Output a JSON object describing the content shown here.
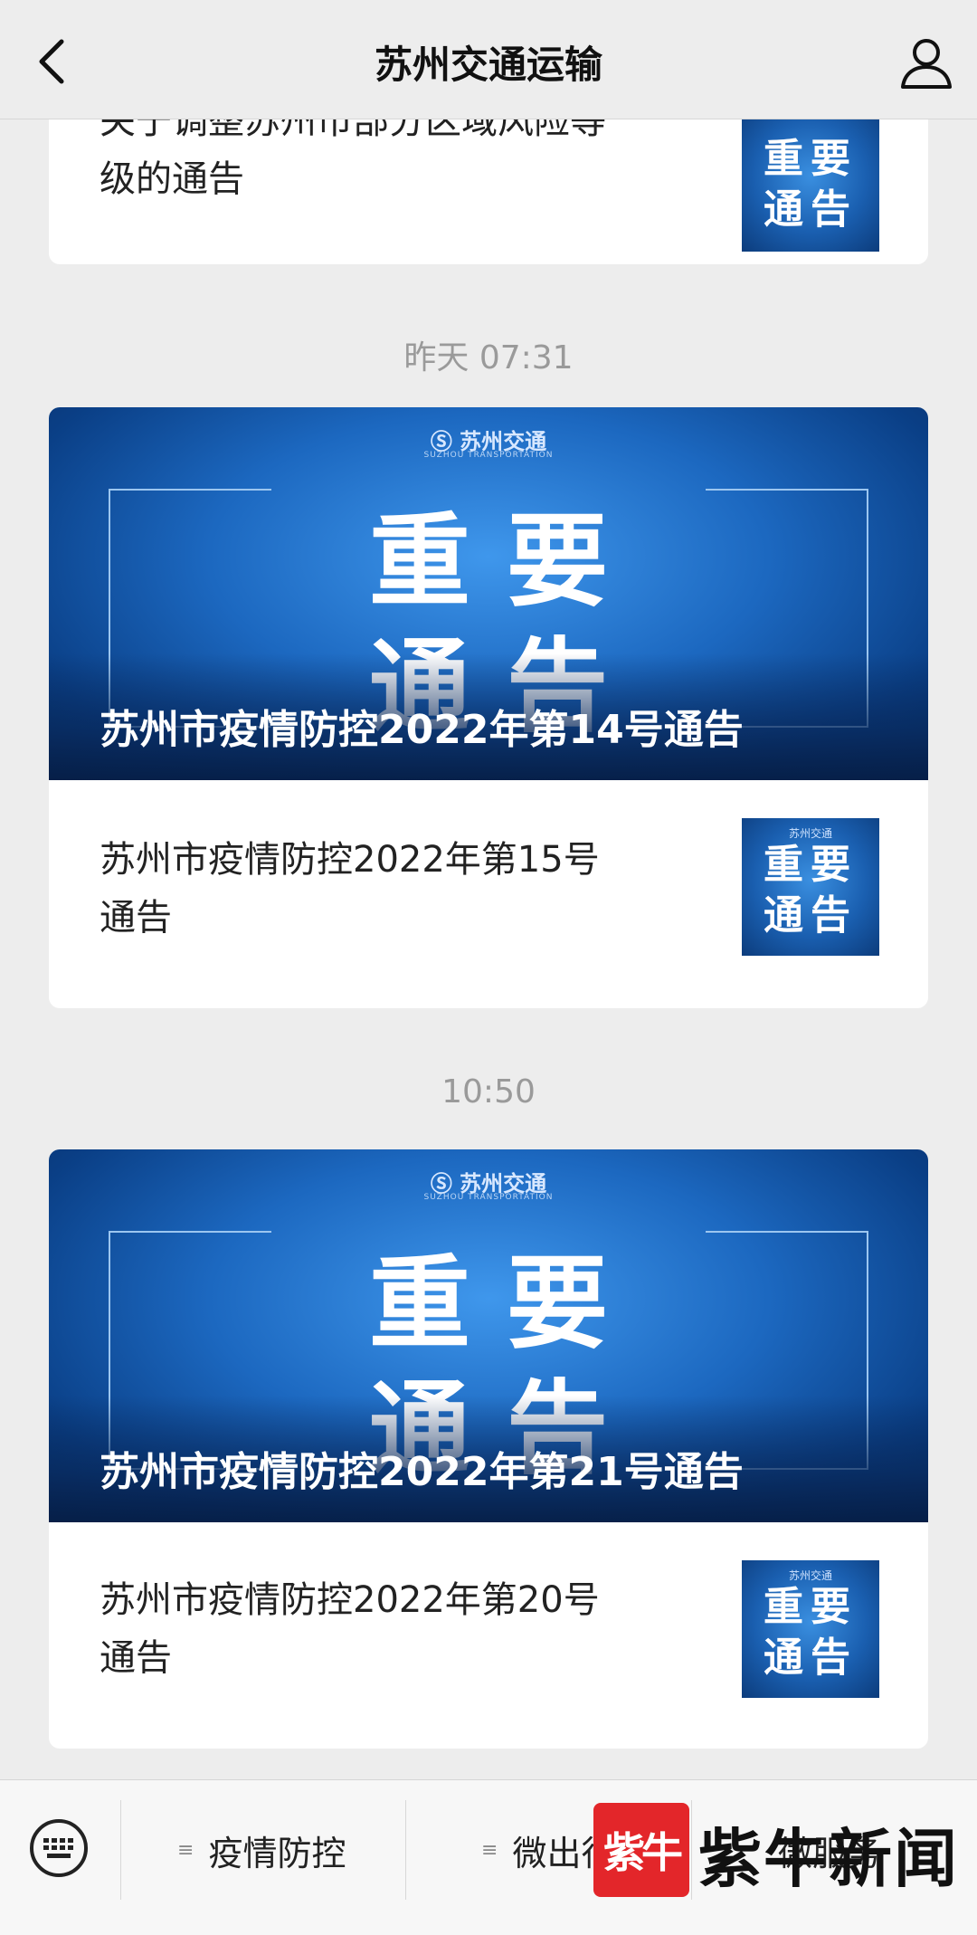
{
  "header": {
    "title": "苏州交通运输"
  },
  "messages": [
    {
      "type": "article",
      "partial_title_line1": "关于调整苏州市部分区域风险等",
      "partial_title_line2": "级的通告",
      "thumb_text_top": "重要",
      "thumb_text_bottom": "通告"
    },
    {
      "timestamp": "昨天 07:31",
      "banner": {
        "logo": "苏州交通",
        "logo_sub": "SUZHOU TRANSPORTATION",
        "big_top": "重要",
        "big_bottom": "通告",
        "headline": "苏州市疫情防控2022年第14号通告"
      },
      "item": {
        "title_line1": "苏州市疫情防控2022年第15号",
        "title_line2": "通告",
        "thumb_logo": "苏州交通",
        "thumb_text_top": "重要",
        "thumb_text_bottom": "通告"
      }
    },
    {
      "timestamp": "10:50",
      "banner": {
        "logo": "苏州交通",
        "logo_sub": "SUZHOU TRANSPORTATION",
        "big_top": "重要",
        "big_bottom": "通告",
        "headline": "苏州市疫情防控2022年第21号通告"
      },
      "item": {
        "title_line1": "苏州市疫情防控2022年第20号",
        "title_line2": "通告",
        "thumb_logo": "苏州交通",
        "thumb_text_top": "重要",
        "thumb_text_bottom": "通告"
      }
    }
  ],
  "bottom_menu": {
    "items": [
      {
        "label": "疫情防控"
      },
      {
        "label": "微出行"
      },
      {
        "label": "微服务"
      }
    ]
  },
  "watermark": {
    "badge": "紫牛",
    "text": "紫牛新闻"
  },
  "colors": {
    "background": "#ededed",
    "banner_blue": "#1c68c0",
    "watermark_red": "#e3262a"
  }
}
